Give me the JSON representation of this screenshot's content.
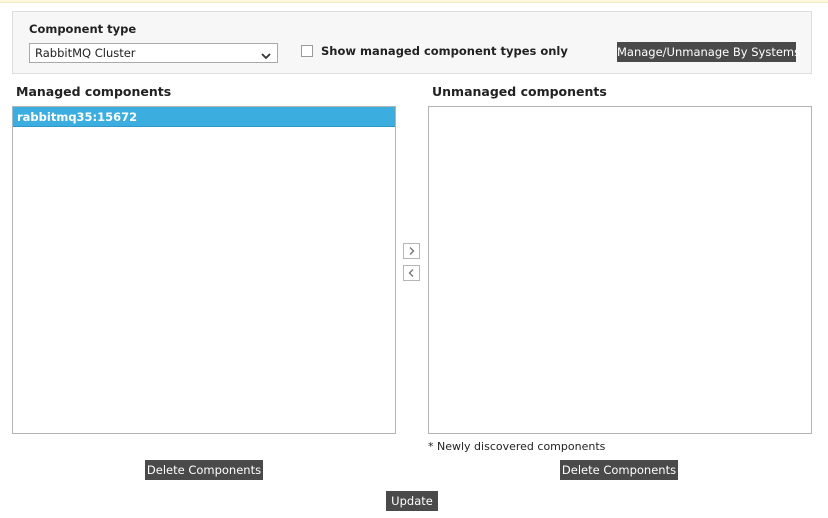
{
  "filter": {
    "component_type_label": "Component type",
    "component_type_value": "RabbitMQ Cluster",
    "show_managed_only_label": "Show managed component types only",
    "show_managed_only_checked": false,
    "manage_by_systems_label": "Manage/Unmanage By Systems"
  },
  "managed": {
    "title": "Managed components",
    "items": [
      "rabbitmq35:15672"
    ],
    "delete_label": "Delete Components"
  },
  "unmanaged": {
    "title": "Unmanaged components",
    "items": [],
    "note": "* Newly discovered components",
    "delete_label": "Delete Components"
  },
  "icons": {
    "move_to_unmanaged": "chevron-right-icon",
    "move_to_managed": "chevron-left-icon",
    "dropdown": "chevron-down-icon"
  },
  "update_label": "Update",
  "colors": {
    "selected_item": "#3badde",
    "button_bg": "#4a4a4a"
  }
}
